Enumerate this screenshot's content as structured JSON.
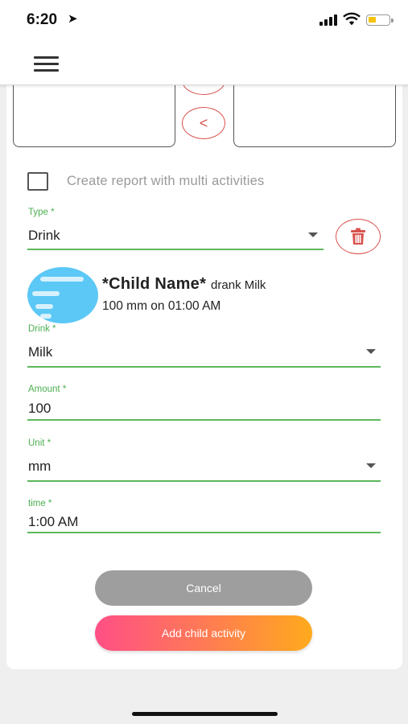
{
  "status_bar": {
    "time": "6:20",
    "location_icon": "location-arrow-icon",
    "signal_icon": "cellular-signal-icon",
    "wifi_icon": "wifi-icon",
    "battery_icon": "battery-icon",
    "battery_color": "#f4c20d"
  },
  "app_bar": {
    "menu_icon": "hamburger-menu-icon"
  },
  "photo_nav": {
    "prev_symbol": "<"
  },
  "multi_activity": {
    "label": "Create report with multi activities",
    "checked": false
  },
  "type_field": {
    "label": "Type *",
    "value": "Drink"
  },
  "delete_button": {
    "icon": "trash-icon",
    "color": "#d9534f"
  },
  "summary": {
    "child_name": "*Child Name*",
    "verb_text": "drank Milk",
    "detail": "100 mm on 01:00 AM"
  },
  "drink_field": {
    "label": "Drink *",
    "value": "Milk"
  },
  "amount_field": {
    "label": "Amount *",
    "value": "100"
  },
  "unit_field": {
    "label": "Unit *",
    "value": "mm"
  },
  "time_field": {
    "label": "time *",
    "value": "1:00 AM"
  },
  "buttons": {
    "cancel_label": "Cancel",
    "add_label": "Add child activity"
  },
  "colors": {
    "accent_green": "#5cb85c",
    "danger_red": "#d9534f",
    "cancel_gray": "#9e9e9e",
    "gradient_start": "#ff4f86",
    "gradient_end": "#ffaa1c"
  }
}
